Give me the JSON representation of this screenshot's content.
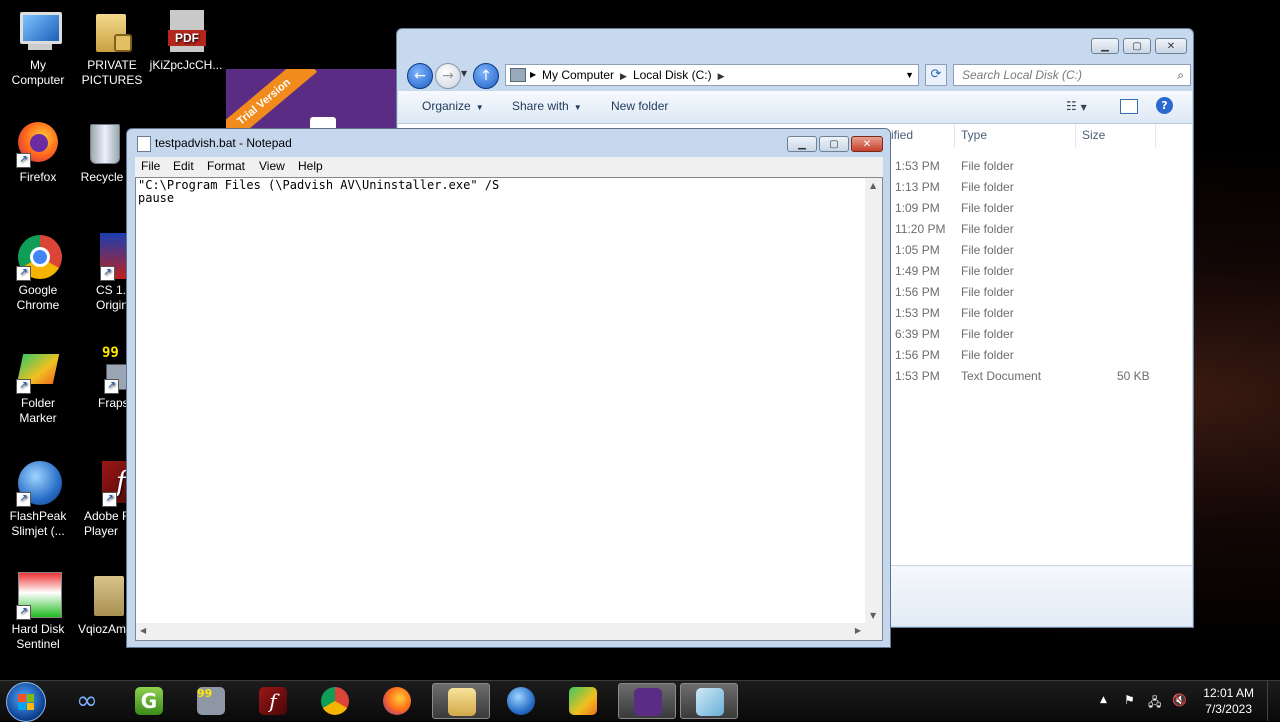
{
  "desktop": {
    "icons": [
      {
        "label": "My\nComputer",
        "icon": "computer-icon"
      },
      {
        "label": "PRIVATE\nPICTURES",
        "icon": "locked-folder-icon"
      },
      {
        "label": "jKiZpcJcCH...",
        "icon": "pdf-icon"
      },
      {
        "label": "Firefox",
        "icon": "firefox-icon"
      },
      {
        "label": "Recycle",
        "icon": "recycle-bin-icon"
      },
      {
        "label": "Google\nChrome",
        "icon": "chrome-icon"
      },
      {
        "label": "CS 1.6\nOrigin",
        "icon": "cs-icon"
      },
      {
        "label": "Folder\nMarker",
        "icon": "folder-marker-icon"
      },
      {
        "label": "Fraps",
        "icon": "fraps-icon"
      },
      {
        "label": "FlashPeak\nSlimjet (...",
        "icon": "slimjet-icon"
      },
      {
        "label": "Adobe Fl\nPlayer",
        "icon": "flash-icon"
      },
      {
        "label": "Hard Disk\nSentinel",
        "icon": "hdd-sentinel-icon"
      },
      {
        "label": "VqiozAm",
        "icon": "folder-icon"
      }
    ],
    "trial_banner": "Trial Version"
  },
  "explorer": {
    "breadcrumb": [
      "My Computer",
      "Local Disk (C:)"
    ],
    "search_placeholder": "Search Local Disk (C:)",
    "commands": {
      "organize": "Organize",
      "share": "Share with",
      "new_folder": "New folder"
    },
    "columns": {
      "modified": "ified",
      "type": "Type",
      "size": "Size"
    },
    "rows": [
      {
        "modified": "1:53 PM",
        "type": "File folder",
        "size": ""
      },
      {
        "modified": "1:13 PM",
        "type": "File folder",
        "size": ""
      },
      {
        "modified": "1:09 PM",
        "type": "File folder",
        "size": ""
      },
      {
        "modified": "11:20 PM",
        "type": "File folder",
        "size": ""
      },
      {
        "modified": "1:05 PM",
        "type": "File folder",
        "size": ""
      },
      {
        "modified": "1:49 PM",
        "type": "File folder",
        "size": ""
      },
      {
        "modified": "1:56 PM",
        "type": "File folder",
        "size": ""
      },
      {
        "modified": "1:53 PM",
        "type": "File folder",
        "size": ""
      },
      {
        "modified": "6:39 PM",
        "type": "File folder",
        "size": ""
      },
      {
        "modified": "1:56 PM",
        "type": "File folder",
        "size": ""
      },
      {
        "modified": "1:53 PM",
        "type": "Text Document",
        "size": "50 KB"
      }
    ]
  },
  "notepad": {
    "title": "testpadvish.bat - Notepad",
    "menu": [
      "File",
      "Edit",
      "Format",
      "View",
      "Help"
    ],
    "content": "\"C:\\Program Files (\\Padvish AV\\Uninstaller.exe\" /S\npause"
  },
  "taskbar": {
    "apps": [
      "infinity-icon",
      "g-icon",
      "fraps-icon",
      "flash-icon",
      "chrome-icon",
      "firefox-icon",
      "explorer-icon",
      "slimjet-icon",
      "padvish-icon",
      "notepad-icon"
    ],
    "clock_time": "12:01 AM",
    "clock_date": "7/3/2023"
  },
  "colors": {
    "accent": "#1e5fc2",
    "trial_purple": "#5b2c83",
    "trial_orange": "#f08b1c"
  }
}
